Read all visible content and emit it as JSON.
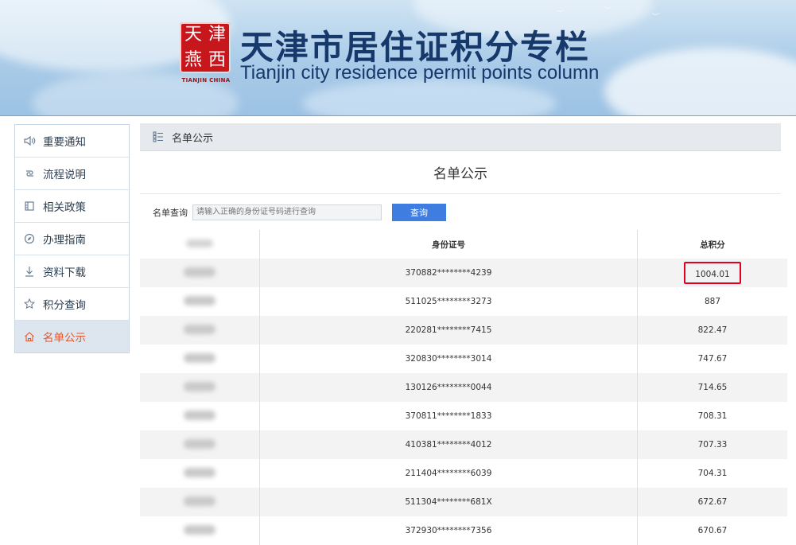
{
  "banner": {
    "title_cn": "天津市居住证积分专栏",
    "title_en": "Tianjin city residence permit points column",
    "seal_chars": [
      "天",
      "津",
      "燕",
      "西"
    ],
    "seal_caption": "TIANJIN CHINA"
  },
  "sidebar": {
    "items": [
      {
        "label": "重要通知",
        "icon": "speaker-icon",
        "active": false
      },
      {
        "label": "流程说明",
        "icon": "link-icon",
        "active": false
      },
      {
        "label": "相关政策",
        "icon": "building-icon",
        "active": false
      },
      {
        "label": "办理指南",
        "icon": "compass-icon",
        "active": false
      },
      {
        "label": "资料下载",
        "icon": "download-icon",
        "active": false
      },
      {
        "label": "积分查询",
        "icon": "star-icon",
        "active": false
      },
      {
        "label": "名单公示",
        "icon": "home-icon",
        "active": true
      }
    ]
  },
  "main": {
    "breadcrumb": "名单公示",
    "heading": "名单公示",
    "search": {
      "label": "名单查询",
      "placeholder": "请输入正确的身份证号码进行查询",
      "button": "查询"
    },
    "table": {
      "headers": [
        "",
        "身份证号",
        "总积分"
      ],
      "rows": [
        {
          "id": "370882********4239",
          "score": "1004.01",
          "highlight": true
        },
        {
          "id": "511025********3273",
          "score": "887"
        },
        {
          "id": "220281********7415",
          "score": "822.47"
        },
        {
          "id": "320830********3014",
          "score": "747.67"
        },
        {
          "id": "130126********0044",
          "score": "714.65"
        },
        {
          "id": "370811********1833",
          "score": "708.31"
        },
        {
          "id": "410381********4012",
          "score": "707.33"
        },
        {
          "id": "211404********6039",
          "score": "704.31"
        },
        {
          "id": "511304********681X",
          "score": "672.67"
        },
        {
          "id": "372930********7356",
          "score": "670.67"
        }
      ]
    }
  },
  "colors": {
    "accent": "#3f7ee0",
    "active_nav": "#e4572e",
    "title_blue": "#17386a",
    "highlight_border": "#e1001f",
    "seal_red": "#c8161d"
  }
}
